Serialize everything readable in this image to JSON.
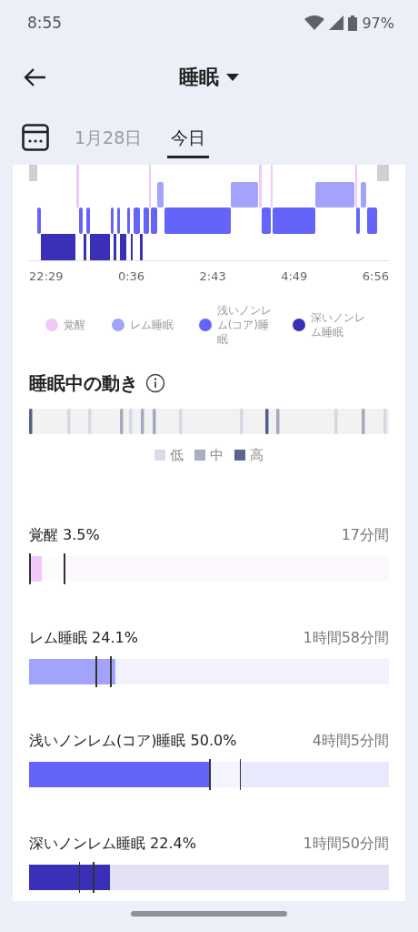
{
  "status_bar": {
    "time": "8:55",
    "battery": "97%"
  },
  "header": {
    "title": "睡眠"
  },
  "tabs": [
    {
      "label": "1月28日",
      "selected": false
    },
    {
      "label": "今日",
      "selected": true
    }
  ],
  "hypnogram": {
    "times": [
      "22:29",
      "0:36",
      "2:43",
      "4:49",
      "6:56"
    ],
    "legend": [
      {
        "label": "覚醒",
        "color": "#f0c8fa"
      },
      {
        "label": "レム睡眠",
        "color": "#a3a3fb"
      },
      {
        "label": "浅いノンレム(コア)睡眠",
        "color": "#6464fb"
      },
      {
        "label": "深いノンレム睡眠",
        "color": "#3a30b8"
      }
    ]
  },
  "movement": {
    "title": "睡眠中の動き",
    "legend": [
      {
        "label": "低",
        "color": "#d8dce5"
      },
      {
        "label": "中",
        "color": "#a9afc3"
      },
      {
        "label": "高",
        "color": "#5a6590"
      }
    ]
  },
  "stages": [
    {
      "label": "覚醒 3.5%",
      "duration": "17分間",
      "level": 0.035,
      "color": "#f0c8fa",
      "range_marks": [
        {
          "level": 0.0
        },
        {
          "level": 0.096
        }
      ]
    },
    {
      "label": "レム睡眠 24.1%",
      "duration": "1時間58分間",
      "level": 0.241,
      "color": "#a3a3fb",
      "range_marks": [
        {
          "level": 0.185
        },
        {
          "level": 0.225
        }
      ]
    },
    {
      "label": "浅いノンレム(コア)睡眠 50.0%",
      "duration": "4時間5分間",
      "level": 0.5,
      "color": "#6464fb",
      "range_marks": [
        {
          "level": 0.5
        },
        {
          "level": 0.585
        }
      ]
    },
    {
      "label": "深いノンレム睡眠 22.4%",
      "duration": "1時間50分間",
      "level": 0.224,
      "color": "#3a30b8",
      "range_marks": [
        {
          "level": 0.138
        },
        {
          "level": 0.178
        }
      ]
    }
  ]
}
